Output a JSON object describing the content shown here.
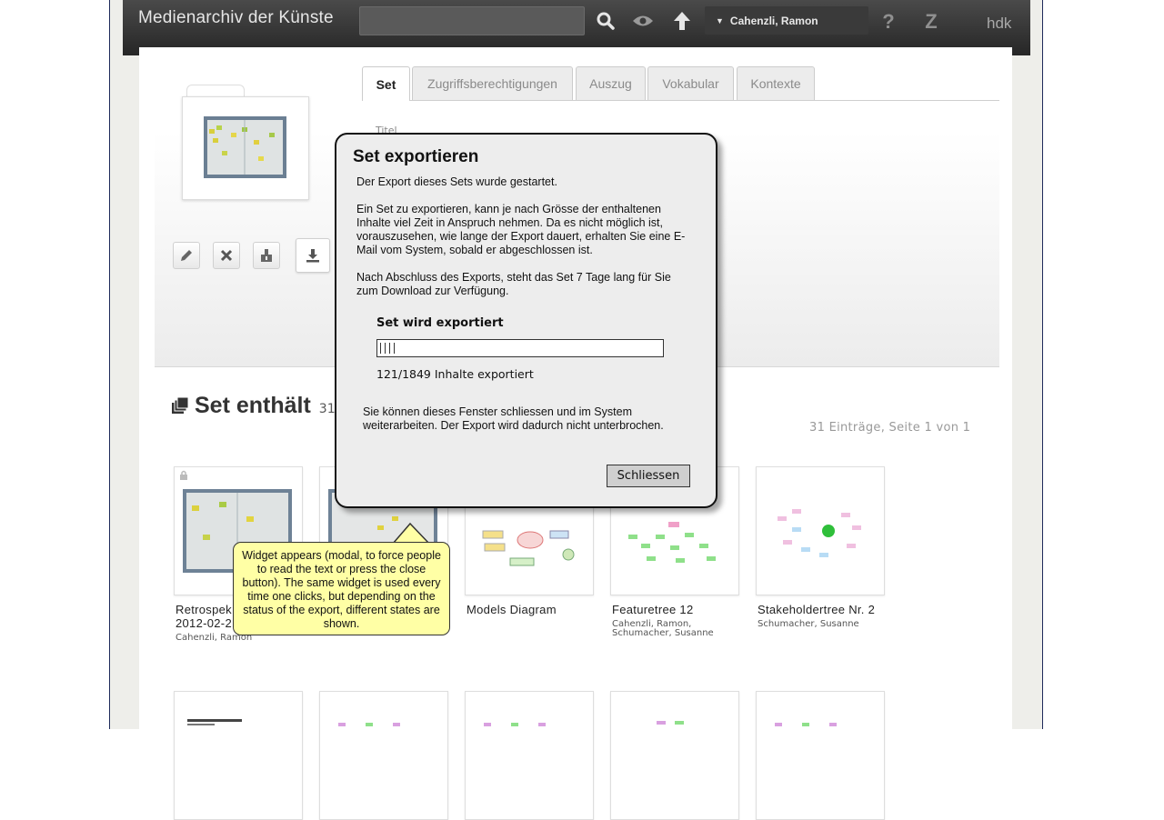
{
  "app": {
    "title": "Medienarchiv der Künste",
    "user": "Cahenzli, Ramon",
    "org": "hdk"
  },
  "search": {
    "placeholder": ""
  },
  "tabs": [
    {
      "label": "Set",
      "active": true
    },
    {
      "label": "Zugriffsberechtigungen"
    },
    {
      "label": "Auszug"
    },
    {
      "label": "Vokabular"
    },
    {
      "label": "Kontexte"
    }
  ],
  "meta": {
    "title_label": "Titel"
  },
  "set_section": {
    "heading": "Set enthält",
    "count": "31",
    "pager": "31 Einträge, Seite 1 von 1"
  },
  "cards": [
    {
      "title1": "Retrospek",
      "title2": "2012-02-2",
      "author1": "Cahenzli, Ramon",
      "author2": "",
      "locked": true
    },
    {
      "title1": "",
      "title2": "",
      "author1": "",
      "author2": ""
    },
    {
      "title1": "Models Diagram",
      "title2": "",
      "author1": "",
      "author2": ""
    },
    {
      "title1": "Featuretree 12",
      "title2": "",
      "author1": "Cahenzli, Ramon,",
      "author2": "Schumacher, Susanne"
    },
    {
      "title1": "Stakeholdertree Nr. 2",
      "title2": "",
      "author1": "Schumacher, Susanne",
      "author2": ""
    }
  ],
  "modal": {
    "title": "Set exportieren",
    "p1": "Der Export dieses Sets wurde gestartet.",
    "p2": "Ein Set zu exportieren, kann je nach Grösse der enthaltenen Inhalte viel Zeit in Anspruch nehmen. Da es nicht möglich ist, vorauszusehen, wie lange der Export dauert, erhalten Sie eine E-Mail vom System, sobald er abgeschlossen ist.",
    "p3": "Nach Abschluss des Exports, steht das Set 7 Tage lang für Sie zum Download zur Verfügung.",
    "progress_title": "Set wird exportiert",
    "progress_done": 121,
    "progress_total": 1849,
    "progress_text": "121/1849 Inhalte exportiert",
    "p4": "Sie können dieses Fenster schliessen und im System weiterarbeiten. Der Export wird dadurch nicht unterbrochen.",
    "close_label": "Schliessen"
  },
  "callout": {
    "text": "Widget appears (modal, to force people to read the text or press the close button). The same widget is used every time one clicks, but depending on the status of the export, different states are shown."
  }
}
